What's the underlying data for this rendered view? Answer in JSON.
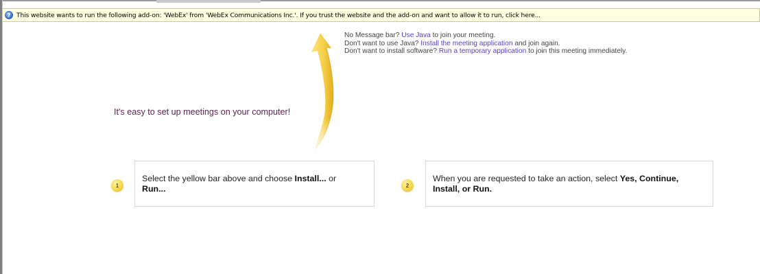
{
  "infobar": {
    "message": "This website wants to run the following add-on: 'WebEx' from 'WebEx Communications Inc.'. If you trust the website and the add-on and want to allow it to run, click here..."
  },
  "alternatives": {
    "line1": {
      "prefix": "No Message bar?",
      "link": "Use Java",
      "suffix": "to join your meeting."
    },
    "line2": {
      "prefix": "Don't want to use Java?",
      "link": "Install the meeting application",
      "suffix": "and join again."
    },
    "line3": {
      "prefix": "Don't want to install software?",
      "link": "Run a temporary application",
      "suffix": "to join this meeting immediately."
    }
  },
  "headline": "It's easy to set up meetings on your computer!",
  "steps": [
    {
      "number": "1",
      "text_before": "Select the yellow bar above and choose",
      "bold1": "Install...",
      "text_middle": "or",
      "bold2": "Run..."
    },
    {
      "number": "2",
      "text_before": "When you are requested to take an action, select",
      "bold1": "Yes, Continue, Install, or Run."
    }
  ],
  "colors": {
    "infobar_bg": "#ffffe1",
    "link": "#5a3fc8",
    "headline": "#5a2350",
    "badge": "#f2cc3a",
    "arrow": "#f6d04a"
  }
}
